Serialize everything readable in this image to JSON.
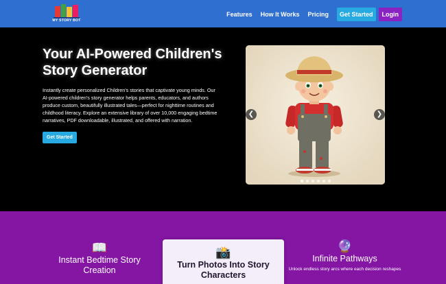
{
  "nav": {
    "logo_text": "MY STORY BOT",
    "links": [
      "Features",
      "How It Works",
      "Pricing"
    ],
    "get_started": "Get Started",
    "login": "Login"
  },
  "hero": {
    "title": "Your AI-Powered Children's Story Generator",
    "description": "Instantly create personalized Children's stories that captivate young minds. Our AI-powered children's story generator helps parents, educators, and authors produce custom, beautifully illustrated tales—perfect for nighttime routines and childhood literacy. Explore an extensive library of over 10,000 engaging bedtime narratives, PDF downloadable, illustrated, and offered with narration.",
    "cta": "Get Started"
  },
  "carousel": {
    "prev": "❮",
    "next": "❯",
    "slide_count": 6,
    "active_slide": 0
  },
  "features": [
    {
      "icon": "📖",
      "icon_name": "open-book-icon",
      "title": "Instant Bedtime Story Creation",
      "desc": ""
    },
    {
      "icon": "📸",
      "icon_name": "camera-icon",
      "title": "Turn Photos Into Story Characters",
      "desc": ""
    },
    {
      "icon": "🔮",
      "icon_name": "crystal-ball-icon",
      "title": "Infinite Pathways",
      "desc": "Unlock endless story arcs where each decision reshapes"
    }
  ],
  "colors": {
    "nav_bg": "#2f6fd0",
    "accent_blue": "#27a9e1",
    "accent_purple": "#8a23c2",
    "features_bg": "#8516a4"
  }
}
